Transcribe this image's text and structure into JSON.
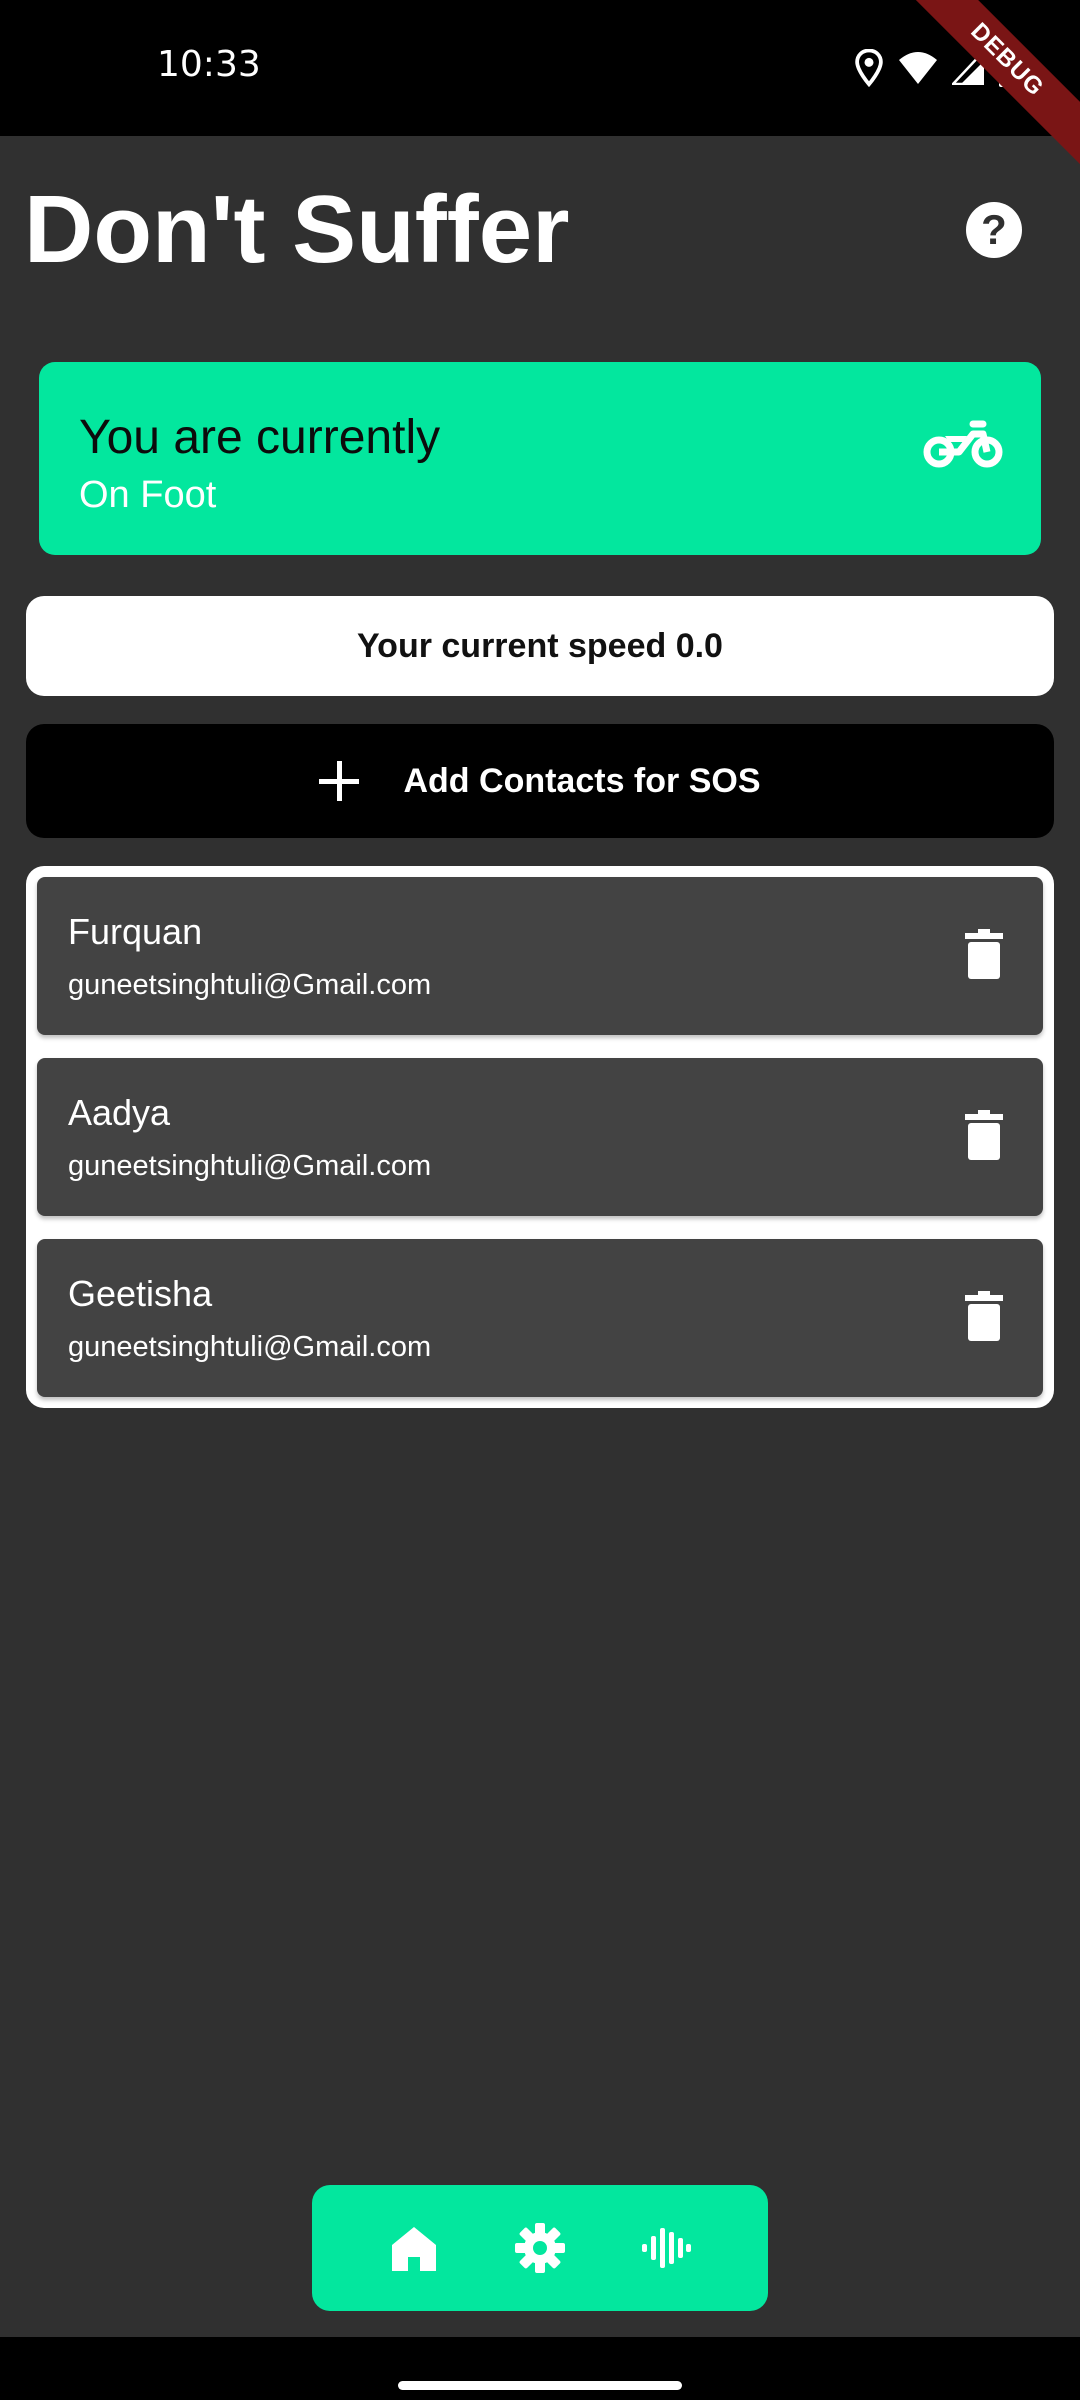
{
  "status_bar": {
    "time": "10:33",
    "icons": [
      "location-icon",
      "wifi-icon",
      "signal-icon",
      "battery-icon"
    ]
  },
  "debug_banner": "DEBUG",
  "header": {
    "title": "Don't Suffer",
    "help_icon": "help-circle-icon"
  },
  "mode_card": {
    "label": "You are currently",
    "value": "On Foot",
    "icon": "motorcycle-icon",
    "color": "#03E79E"
  },
  "speed": {
    "text": "Your current speed 0.0"
  },
  "add_contacts": {
    "label": "Add Contacts for SOS",
    "icon": "plus-icon"
  },
  "contacts": [
    {
      "name": "Furquan",
      "email": "guneetsinghtuli@Gmail.com"
    },
    {
      "name": "Aadya",
      "email": "guneetsinghtuli@Gmail.com"
    },
    {
      "name": "Geetisha",
      "email": "guneetsinghtuli@Gmail.com"
    }
  ],
  "nav": {
    "items": [
      "home-icon",
      "settings-icon",
      "audio-waveform-icon"
    ]
  },
  "colors": {
    "accent": "#03E79E",
    "background": "#303030",
    "card": "#434343"
  }
}
